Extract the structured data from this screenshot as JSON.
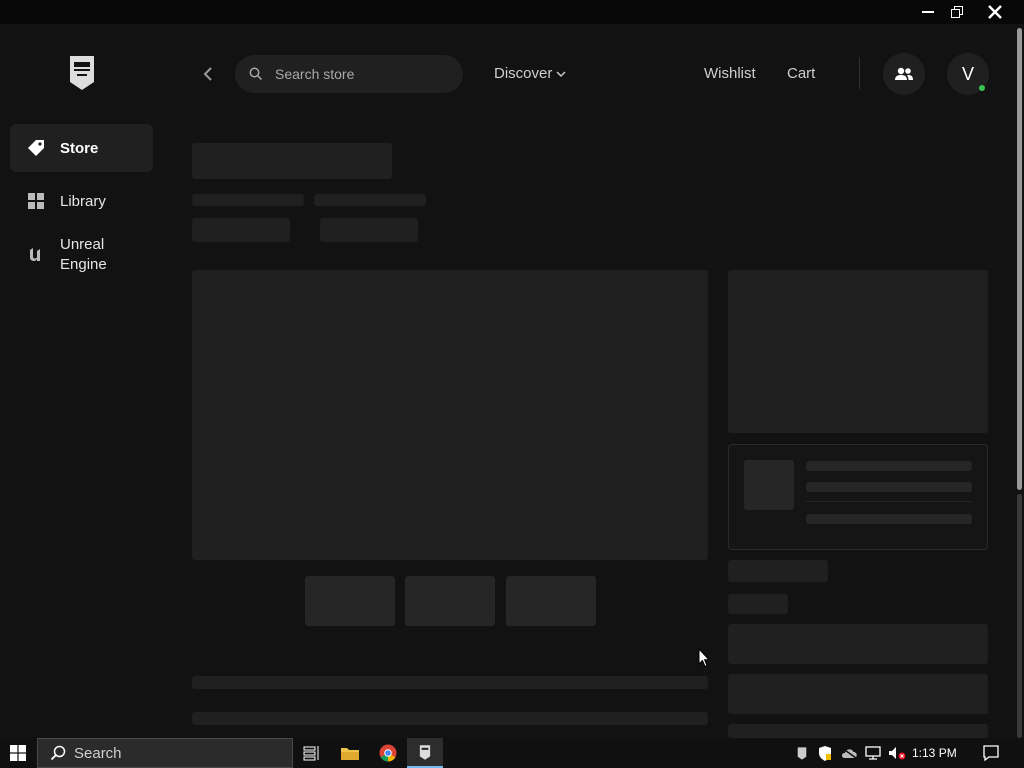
{
  "sidebar": {
    "items": [
      {
        "label": "Store",
        "icon": "tag-icon"
      },
      {
        "label": "Library",
        "icon": "grid-icon"
      },
      {
        "label": "Unreal Engine",
        "icon": "unreal-icon"
      }
    ]
  },
  "header": {
    "search_placeholder": "Search store",
    "discover": "Discover",
    "wishlist": "Wishlist",
    "cart": "Cart",
    "avatar_initial": "V"
  },
  "taskbar": {
    "search_label": "Search",
    "clock": "1:13 PM"
  },
  "colors": {
    "background": "#121212",
    "skeleton": "#202020",
    "online": "#36c551",
    "taskbar_accent": "#76b9ed"
  }
}
